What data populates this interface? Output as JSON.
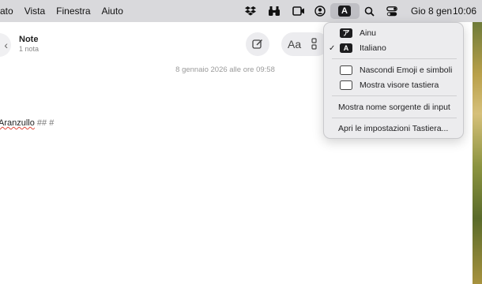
{
  "menubar": {
    "menus": [
      "ato",
      "Vista",
      "Finestra",
      "Aiuto"
    ],
    "date": "Gio 8 gen",
    "time": "10:06",
    "input_badge": "A",
    "icons": [
      "dropbox-icon",
      "binoculars-icon",
      "screen-record-icon",
      "user-circle-icon",
      "input-source-icon",
      "search-icon",
      "control-center-icon"
    ]
  },
  "note_window": {
    "title": "Note",
    "subtitle": "1 nota",
    "aa_label": "Aa",
    "date_line": "8 gennaio 2026 alle ore 09:58",
    "body_word": "Aranzullo",
    "body_rest": " ## #"
  },
  "input_menu": {
    "items": [
      {
        "label": "Ainu",
        "icon": "ainu-keyboard-icon",
        "checked": false,
        "icon_glyph": "ア"
      },
      {
        "label": "Italiano",
        "icon": "italian-keyboard-icon",
        "checked": true,
        "icon_glyph": "A"
      },
      {
        "label": "Nascondi Emoji e simboli",
        "icon": "emoji-viewer-icon"
      },
      {
        "label": "Mostra visore tastiera",
        "icon": "keyboard-viewer-icon"
      },
      {
        "label": "Mostra nome sorgente di input"
      },
      {
        "label": "Apri le impostazioni Tastiera..."
      }
    ],
    "check_mark": "✓"
  }
}
